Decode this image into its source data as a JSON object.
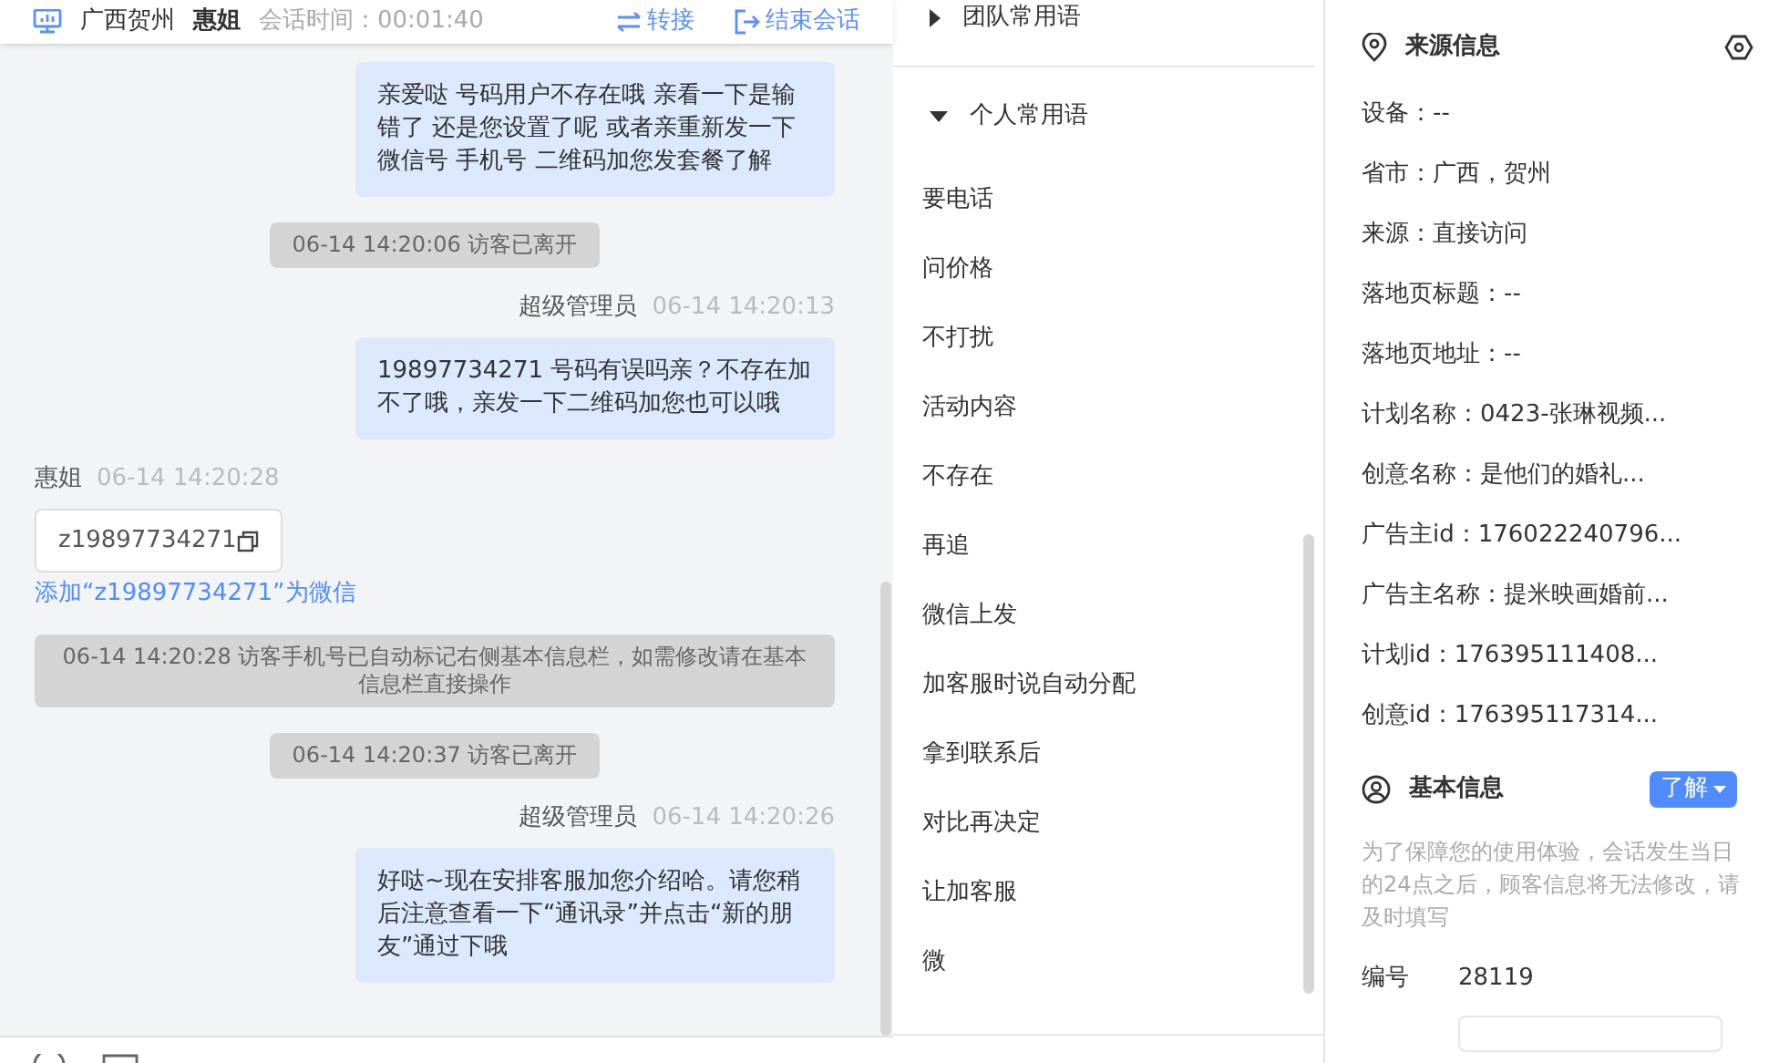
{
  "chat_header": {
    "region": "广西贺州",
    "visitor": "惠姐",
    "duration": "会话时间：00:01:40",
    "actions": [
      {
        "kind": "transfer",
        "label": "转接"
      },
      {
        "kind": "end",
        "label": "结束会话"
      }
    ]
  },
  "messages": [
    {
      "kind": "agent",
      "text": "亲爱哒 号码用户不存在哦 亲看一下是输错了 还是您设置了呢 或者亲重新发一下微信号 手机号 二维码加您发套餐了解"
    },
    {
      "kind": "system",
      "text": "06-14 14:20:06 访客已离开"
    },
    {
      "kind": "agent",
      "sender": "超级管理员",
      "time": "06-14 14:20:13",
      "text": "19897734271  号码有误吗亲？不存在加不了哦，亲发一下二维码加您也可以哦"
    },
    {
      "kind": "visitor",
      "sender": "惠姐",
      "time": "06-14 14:20:28",
      "card": "z19897734271",
      "link": "添加“z19897734271”为微信"
    },
    {
      "kind": "system",
      "text": "06-14 14:20:28 访客手机号已自动标记右侧基本信息栏，如需修改请在基本信息栏直接操作"
    },
    {
      "kind": "system",
      "text": "06-14 14:20:37 访客已离开"
    },
    {
      "kind": "agent",
      "sender": "超级管理员",
      "time": "06-14 14:20:26",
      "text": "好哒~现在安排客服加您介绍哈。请您稍后注意查看一下“通讯录”并点击“新的朋友”通过下哦"
    }
  ],
  "phrase_groups": [
    {
      "title": "团队常用语",
      "expanded": false
    },
    {
      "title": "个人常用语",
      "expanded": true,
      "items": [
        "要电话",
        "问价格",
        "不打扰",
        "活动内容",
        "不存在",
        "再追",
        "微信上发",
        "加客服时说自动分配",
        "拿到联系后",
        "对比再决定",
        "让加客服",
        "微"
      ]
    }
  ],
  "source_info": {
    "title": "来源信息",
    "rows": [
      "设备：--",
      "省市：广西，贺州",
      "来源：直接访问",
      "落地页标题：--",
      "落地页地址：--",
      "计划名称：0423-张琳视频...",
      "创意名称：是他们的婚礼...",
      "广告主id：176022240796...",
      "广告主名称：提米映画婚前...",
      "计划id：176395111408...",
      "创意id：176395117314..."
    ]
  },
  "basic_info": {
    "title": "基本信息",
    "button": "了解",
    "note": "为了保障您的使用体验，会话发生当日的24点之后，顾客信息将无法修改，请及时填写",
    "fields": [
      {
        "label": "编号",
        "value": "28119"
      }
    ]
  }
}
